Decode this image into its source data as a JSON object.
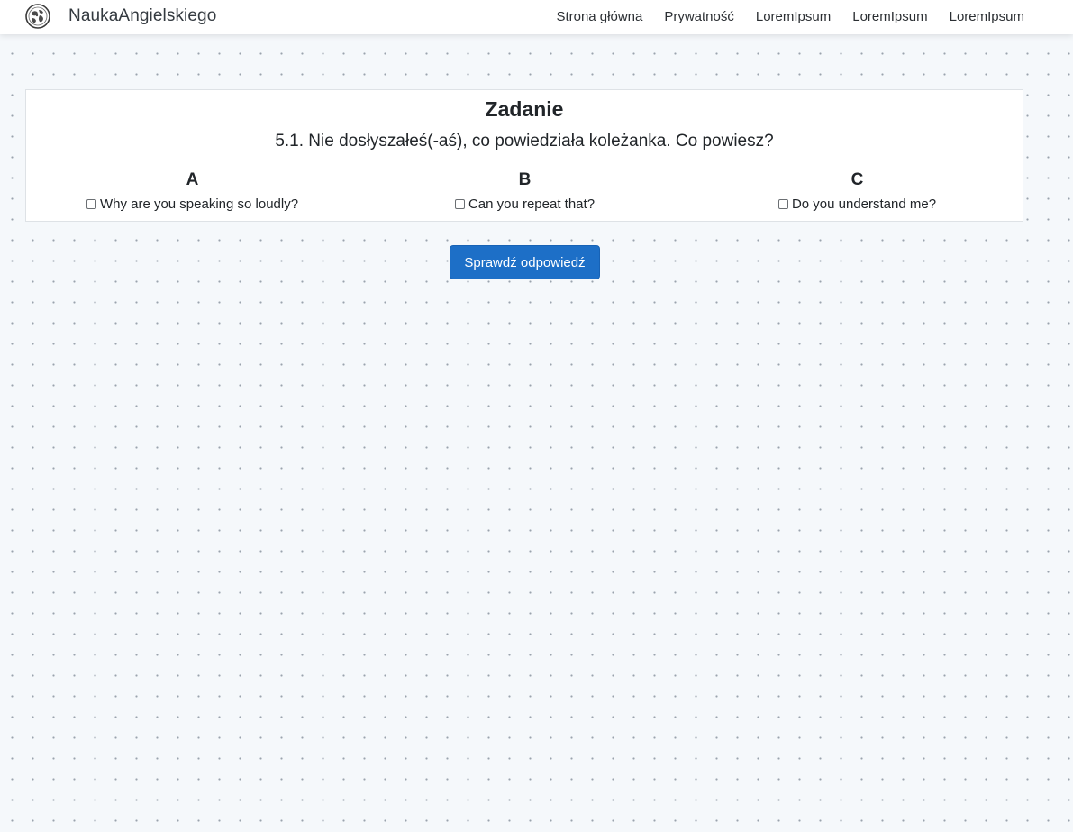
{
  "header": {
    "brand": "NaukaAngielskiego",
    "logo_icon": "globe-logo-icon",
    "nav": [
      {
        "label": "Strona główna"
      },
      {
        "label": "Prywatność"
      },
      {
        "label": "LoremIpsum"
      },
      {
        "label": "LoremIpsum"
      },
      {
        "label": "LoremIpsum"
      }
    ]
  },
  "task": {
    "title": "Zadanie",
    "question": "5.1. Nie dosłyszałeś(-aś), co powiedziała koleżanka. Co powiesz?",
    "options": [
      {
        "letter": "A",
        "text": "Why are you speaking so loudly?",
        "checked": false
      },
      {
        "letter": "B",
        "text": "Can you repeat that?",
        "checked": false
      },
      {
        "letter": "C",
        "text": "Do you understand me?",
        "checked": false
      }
    ]
  },
  "actions": {
    "check_label": "Sprawdź odpowiedź"
  },
  "colors": {
    "primary_button": "#1d6fc7",
    "background": "#f5f8fb"
  }
}
